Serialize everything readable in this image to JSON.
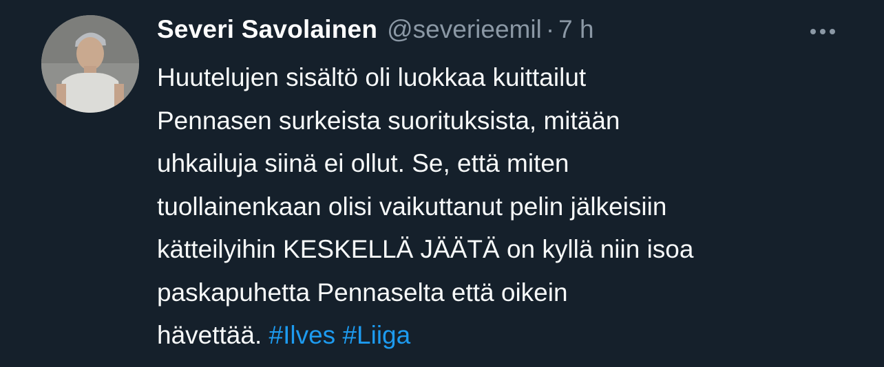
{
  "tweet": {
    "author": {
      "display_name": "Severi Savolainen",
      "handle": "@severieemil",
      "avatar_icon": "profile-photo"
    },
    "separator": "·",
    "time": "7 h",
    "more_icon": "more-horizontal-icon",
    "text_lines": [
      "Huutelujen sisältö oli luokkaa kuittailut",
      "Pennasen surkeista suorituksista, mitään",
      "uhkailuja siinä ei ollut. Se, että miten",
      "tuollainenkaan olisi vaikuttanut pelin jälkeisiin",
      "kätteilyihin KESKELLÄ JÄÄTÄ on kyllä niin isoa",
      "paskapuhetta Pennaselta että oikein"
    ],
    "last_line_text": "hävettää.",
    "hashtags": [
      "#Ilves",
      "#Liiga"
    ]
  },
  "colors": {
    "background": "#15202b",
    "text": "#f7f9f9",
    "secondary": "#8b98a5",
    "link": "#1d9bf0"
  }
}
